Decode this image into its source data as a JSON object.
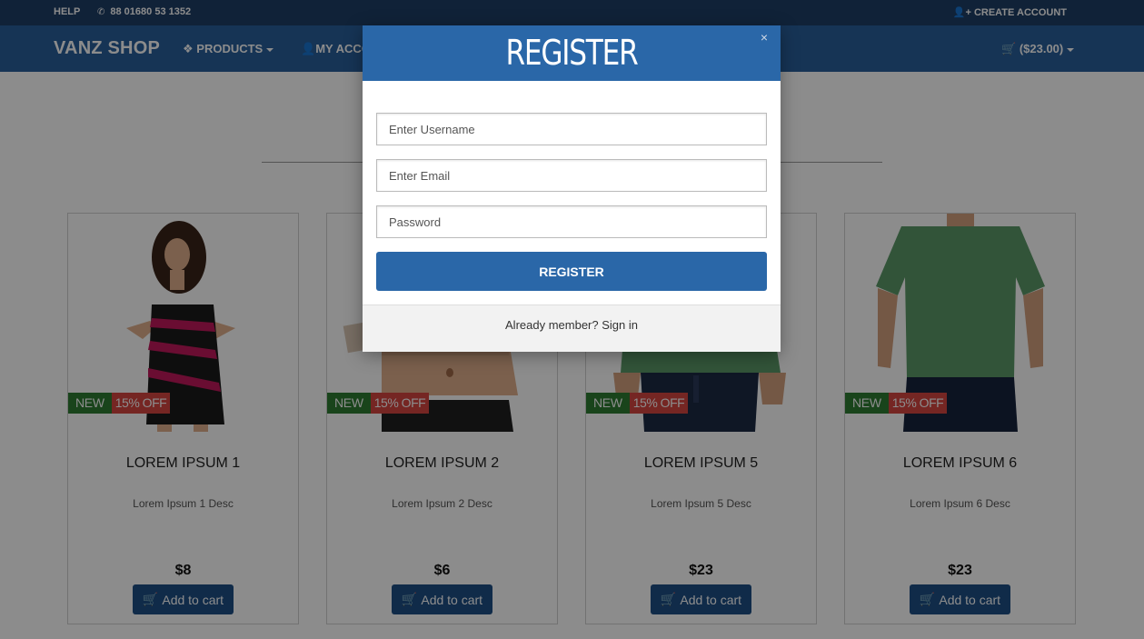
{
  "topbar": {
    "help": "HELP",
    "phone": "88 01680 53 1352",
    "create_account": "CREATE ACCOUNT"
  },
  "navbar": {
    "brand": "VANZ SHOP",
    "products": "PRODUCTS",
    "account": "MY ACCO",
    "cart": "($23.00)"
  },
  "products": [
    {
      "title": "LOREM IPSUM 1",
      "desc": "Lorem Ipsum 1 Desc",
      "price": "$8",
      "badge_new": "NEW",
      "badge_off": "15% OFF",
      "button": "Add to cart"
    },
    {
      "title": "LOREM IPSUM 2",
      "desc": "Lorem Ipsum 2 Desc",
      "price": "$6",
      "badge_new": "NEW",
      "badge_off": "15% OFF",
      "button": "Add to cart"
    },
    {
      "title": "LOREM IPSUM 5",
      "desc": "Lorem Ipsum 5 Desc",
      "price": "$23",
      "badge_new": "NEW",
      "badge_off": "15% OFF",
      "button": "Add to cart"
    },
    {
      "title": "LOREM IPSUM 6",
      "desc": "Lorem Ipsum 6 Desc",
      "price": "$23",
      "badge_new": "NEW",
      "badge_off": "15% OFF",
      "button": "Add to cart"
    }
  ],
  "modal": {
    "title": "REGISTER",
    "close": "×",
    "username_placeholder": "Enter Username",
    "email_placeholder": "Enter Email",
    "password_placeholder": "Password",
    "register_button": "REGISTER",
    "signin_text": "Already member? Sign in"
  },
  "icons": {
    "phone": "phone-icon",
    "create_account": "user-plus-icon",
    "products": "cubes-icon",
    "account": "user-icon",
    "cart": "shopping-cart-icon",
    "close": "close-icon"
  },
  "colors": {
    "topbar": "#1e3e66",
    "navbar": "#285f9c",
    "modal_header": "#2a67a8",
    "button": "#1e4f86",
    "badge_new": "#2e7d32",
    "badge_off": "#d64541"
  }
}
